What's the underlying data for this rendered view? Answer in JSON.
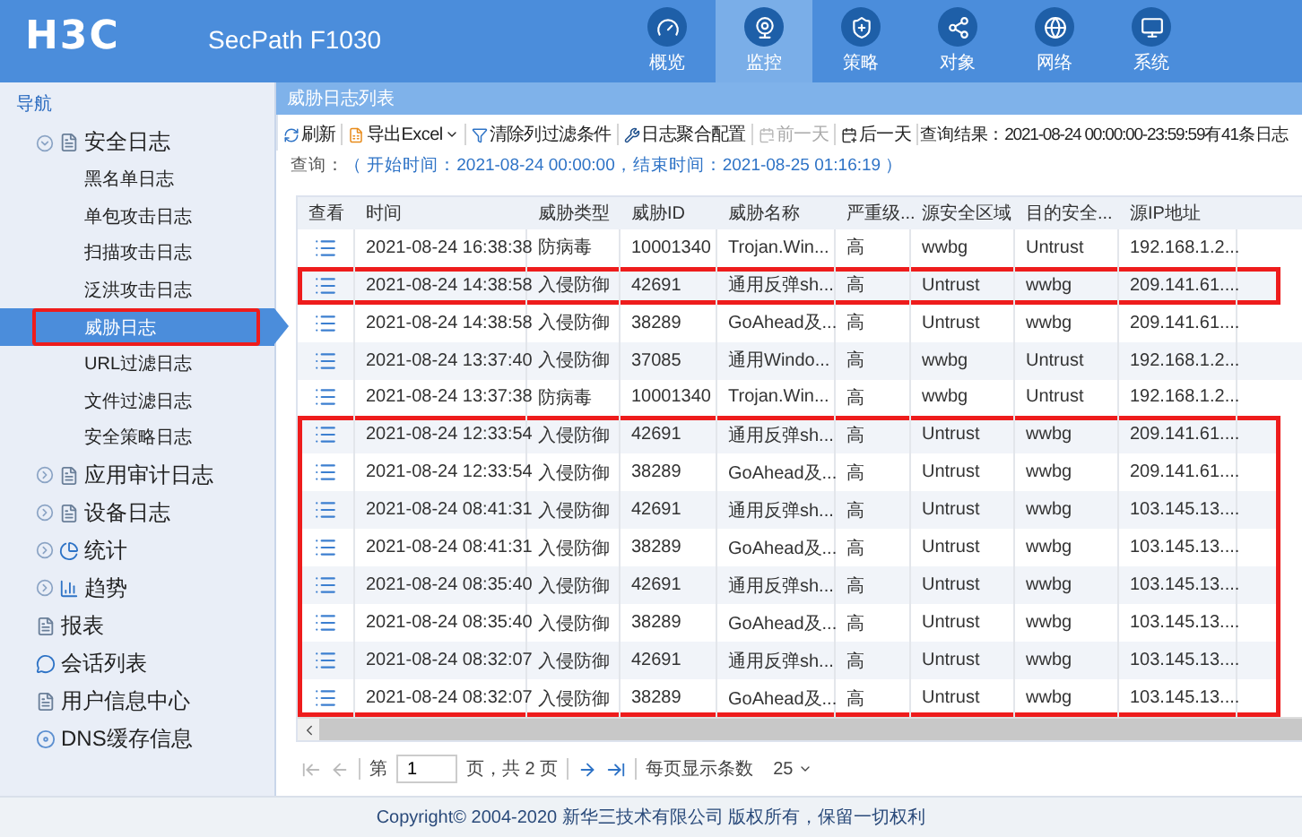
{
  "header": {
    "logo": "H3C",
    "product": "SecPath F1030",
    "nav": [
      {
        "label": "概览",
        "selected": false
      },
      {
        "label": "监控",
        "selected": true
      },
      {
        "label": "策略",
        "selected": false
      },
      {
        "label": "对象",
        "selected": false
      },
      {
        "label": "网络",
        "selected": false
      },
      {
        "label": "系统",
        "selected": false
      }
    ]
  },
  "sidebar": {
    "title": "导航",
    "items": [
      {
        "label": "安全日志",
        "kind": "folder",
        "expanded": true,
        "selected": false,
        "marked": false,
        "children": [
          {
            "label": "黑名单日志",
            "selected": false,
            "marked": false
          },
          {
            "label": "单包攻击日志",
            "selected": false,
            "marked": false
          },
          {
            "label": "扫描攻击日志",
            "selected": false,
            "marked": false
          },
          {
            "label": "泛洪攻击日志",
            "selected": false,
            "marked": false
          },
          {
            "label": "威胁日志",
            "selected": true,
            "marked": true
          },
          {
            "label": "URL过滤日志",
            "selected": false,
            "marked": false
          },
          {
            "label": "文件过滤日志",
            "selected": false,
            "marked": false
          },
          {
            "label": "安全策略日志",
            "selected": false,
            "marked": false
          }
        ]
      },
      {
        "label": "应用审计日志",
        "kind": "folder",
        "expanded": false,
        "selected": false,
        "marked": false
      },
      {
        "label": "设备日志",
        "kind": "folder",
        "expanded": false,
        "selected": false,
        "marked": false
      },
      {
        "label": "统计",
        "kind": "pie",
        "expanded": false,
        "selected": false,
        "marked": false
      },
      {
        "label": "趋势",
        "kind": "trend",
        "expanded": false,
        "selected": false,
        "marked": false
      },
      {
        "label": "报表",
        "kind": "doc",
        "selected": false,
        "marked": false
      },
      {
        "label": "会话列表",
        "kind": "chat",
        "selected": false,
        "marked": false
      },
      {
        "label": "用户信息中心",
        "kind": "doc",
        "selected": false,
        "marked": false
      },
      {
        "label": "DNS缓存信息",
        "kind": "globe",
        "selected": false,
        "marked": false
      }
    ]
  },
  "panel": {
    "title": "威胁日志列表",
    "toolbar": [
      {
        "label": "刷新",
        "kind": "refresh",
        "disabled": false
      },
      {
        "label": "导出Excel",
        "kind": "export",
        "disabled": false
      },
      {
        "label": "清除列过滤条件",
        "kind": "filter",
        "disabled": false
      },
      {
        "label": "日志聚合配置",
        "kind": "wrench",
        "disabled": false
      },
      {
        "label": "前一天",
        "kind": "prev",
        "disabled": true
      },
      {
        "label": "后一天",
        "kind": "next",
        "disabled": false
      }
    ],
    "result": "查询结果：2021-08-24 00:00:00-23:59:59有41条日志",
    "query_label": "查询：",
    "query": "（ 开始时间：2021-08-24 00:00:00，结束时间：2021-08-25 01:16:19 ）",
    "table": {
      "view_column": "查看",
      "columns": [
        "时间",
        "威胁类型",
        "威胁ID",
        "威胁名称",
        "严重级...",
        "源安全区域",
        "目的安全...",
        "源IP地址"
      ],
      "rows": [
        {
          "cells": [
            "2021-08-24 16:38:38",
            "防病毒",
            "10001340",
            "Trojan.Win...",
            "高",
            "wwbg",
            "Untrust",
            "192.168.1.2..."
          ],
          "marked": false
        },
        {
          "cells": [
            "2021-08-24 14:38:58",
            "入侵防御",
            "42691",
            "通用反弹sh...",
            "高",
            "Untrust",
            "wwbg",
            "209.141.61...."
          ],
          "marked": true
        },
        {
          "cells": [
            "2021-08-24 14:38:58",
            "入侵防御",
            "38289",
            "GoAhead及...",
            "高",
            "Untrust",
            "wwbg",
            "209.141.61...."
          ],
          "marked": false
        },
        {
          "cells": [
            "2021-08-24 13:37:40",
            "入侵防御",
            "37085",
            "通用Windo...",
            "高",
            "wwbg",
            "Untrust",
            "192.168.1.2..."
          ],
          "marked": false
        },
        {
          "cells": [
            "2021-08-24 13:37:38",
            "防病毒",
            "10001340",
            "Trojan.Win...",
            "高",
            "wwbg",
            "Untrust",
            "192.168.1.2..."
          ],
          "marked": false
        },
        {
          "cells": [
            "2021-08-24 12:33:54",
            "入侵防御",
            "42691",
            "通用反弹sh...",
            "高",
            "Untrust",
            "wwbg",
            "209.141.61...."
          ],
          "marked": true
        },
        {
          "cells": [
            "2021-08-24 12:33:54",
            "入侵防御",
            "38289",
            "GoAhead及...",
            "高",
            "Untrust",
            "wwbg",
            "209.141.61...."
          ],
          "marked": true
        },
        {
          "cells": [
            "2021-08-24 08:41:31",
            "入侵防御",
            "42691",
            "通用反弹sh...",
            "高",
            "Untrust",
            "wwbg",
            "103.145.13...."
          ],
          "marked": true
        },
        {
          "cells": [
            "2021-08-24 08:41:31",
            "入侵防御",
            "38289",
            "GoAhead及...",
            "高",
            "Untrust",
            "wwbg",
            "103.145.13...."
          ],
          "marked": true
        },
        {
          "cells": [
            "2021-08-24 08:35:40",
            "入侵防御",
            "42691",
            "通用反弹sh...",
            "高",
            "Untrust",
            "wwbg",
            "103.145.13...."
          ],
          "marked": true
        },
        {
          "cells": [
            "2021-08-24 08:35:40",
            "入侵防御",
            "38289",
            "GoAhead及...",
            "高",
            "Untrust",
            "wwbg",
            "103.145.13...."
          ],
          "marked": true
        },
        {
          "cells": [
            "2021-08-24 08:32:07",
            "入侵防御",
            "42691",
            "通用反弹sh...",
            "高",
            "Untrust",
            "wwbg",
            "103.145.13...."
          ],
          "marked": true
        },
        {
          "cells": [
            "2021-08-24 08:32:07",
            "入侵防御",
            "38289",
            "GoAhead及...",
            "高",
            "Untrust",
            "wwbg",
            "103.145.13...."
          ],
          "marked": true
        }
      ]
    },
    "pager": {
      "page_prefix": "第",
      "page": "1",
      "page_suffix": "页，共 2 页",
      "size_label": "每页显示条数",
      "size": "25"
    }
  },
  "footer": "Copyright© 2004-2020 新华三技术有限公司 版权所有，保留一切权利"
}
